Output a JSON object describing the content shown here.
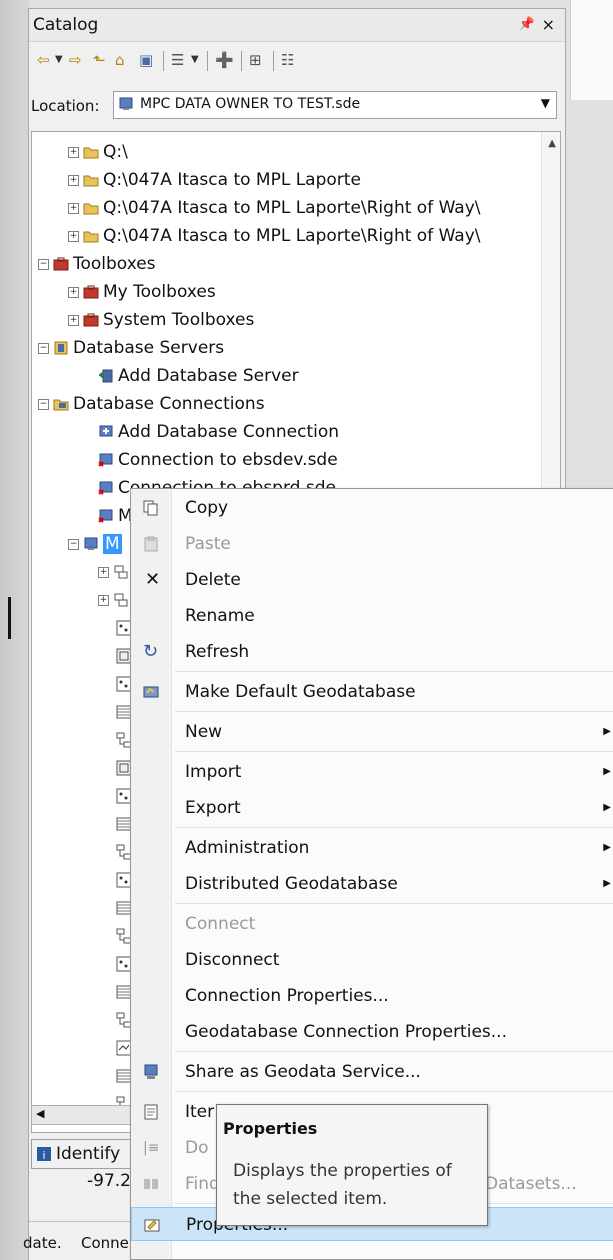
{
  "catalog": {
    "title": "Catalog",
    "pin": " ⪢",
    "close": "×",
    "location_label": "Location:",
    "location_value": "MPC DATA OWNER TO TEST.sde"
  },
  "toolbar": {
    "items": [
      "back",
      "forward",
      "up",
      "home",
      "connect",
      "view",
      "new",
      "tree",
      "list"
    ]
  },
  "tree": {
    "items": [
      {
        "label": "Q:\\",
        "expander": "+"
      },
      {
        "label": "Q:\\047A Itasca to MPL Laporte",
        "expander": "+"
      },
      {
        "label": "Q:\\047A Itasca to MPL Laporte\\Right of Way\\",
        "expander": "+"
      },
      {
        "label": "Q:\\047A Itasca to MPL Laporte\\Right of Way\\",
        "expander": "+"
      },
      {
        "label": "Toolboxes",
        "expander": "−"
      },
      {
        "label": "My Toolboxes",
        "expander": "+"
      },
      {
        "label": "System Toolboxes",
        "expander": "+"
      },
      {
        "label": "Database Servers",
        "expander": "−"
      },
      {
        "label": "Add Database Server",
        "expander": ""
      },
      {
        "label": "Database Connections",
        "expander": "−"
      },
      {
        "label": "Add Database Connection",
        "expander": ""
      },
      {
        "label": "Connection to ebsdev.sde",
        "expander": ""
      },
      {
        "label": "Connection to ebsprd.sde",
        "expander": ""
      },
      {
        "label": "M",
        "expander": ""
      },
      {
        "label": "M",
        "expander": "−"
      }
    ]
  },
  "menu": {
    "items": [
      {
        "label": "Copy",
        "icon": "copy-icon"
      },
      {
        "label": "Paste",
        "icon": "paste-icon"
      },
      {
        "label": "Delete",
        "icon": "delete-icon"
      },
      {
        "label": "Rename",
        "icon": ""
      },
      {
        "label": "Refresh",
        "icon": "refresh-icon"
      },
      {
        "label": "Make Default Geodatabase",
        "icon": "default-geodatabase-icon"
      },
      {
        "label": "New",
        "icon": ""
      },
      {
        "label": "Import",
        "icon": ""
      },
      {
        "label": "Export",
        "icon": ""
      },
      {
        "label": "Administration",
        "icon": ""
      },
      {
        "label": "Distributed Geodatabase",
        "icon": ""
      },
      {
        "label": "Connect",
        "icon": ""
      },
      {
        "label": "Disconnect",
        "icon": ""
      },
      {
        "label": "Connection Properties...",
        "icon": ""
      },
      {
        "label": "Geodatabase Connection Properties...",
        "icon": ""
      },
      {
        "label": "Share as Geodata Service...",
        "icon": "share-icon"
      },
      {
        "label": "Iter",
        "icon": "item-description-icon"
      },
      {
        "label": "Do",
        "icon": "domains-icon"
      },
      {
        "label": "Find",
        "icon": "find-icon"
      },
      {
        "label": "Properties...",
        "icon": "properties-icon"
      }
    ],
    "submenu_arrow": "▶",
    "datasets_fragment": "Datasets..."
  },
  "tooltip": {
    "title": "Properties",
    "body": "Displays the properties of the selected item."
  },
  "bottom": {
    "identify_tab": "Identify",
    "coordinate": "-97.2",
    "status_1": "date.",
    "status_2": "Conne"
  }
}
